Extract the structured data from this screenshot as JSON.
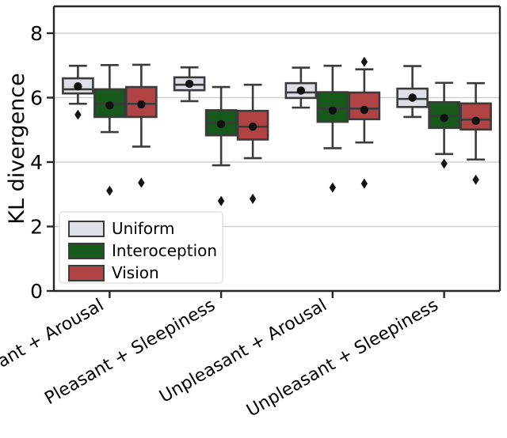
{
  "chart_data": {
    "type": "box",
    "title": "",
    "xlabel": "",
    "ylabel": "KL divergence",
    "ylim": [
      0,
      8.9
    ],
    "yticks": [
      0,
      2,
      4,
      6,
      8
    ],
    "ytick_labels": [
      "0",
      "2",
      "4",
      "6",
      "8"
    ],
    "grid": "horizontal",
    "categories": [
      "Pleasant + Arousal",
      "Pleasant + Sleepiness",
      "Unpleasant + Arousal",
      "Unpleasant + Sleepiness"
    ],
    "xtick_rotation": -30,
    "legend": {
      "position": "lower left",
      "entries": [
        {
          "name": "Uniform",
          "color": "#dee0e8"
        },
        {
          "name": "Interoception",
          "color": "#17591b"
        },
        {
          "name": "Vision",
          "color": "#b04343"
        }
      ]
    },
    "series": [
      {
        "name": "Uniform",
        "color": "#dee0e8",
        "boxes": [
          {
            "category": "Pleasant + Arousal",
            "whisker_low": 5.81,
            "q1": 6.13,
            "median": 6.26,
            "q3": 6.6,
            "whisker_high": 6.99,
            "mean": 6.35,
            "outliers": [
              5.47
            ]
          },
          {
            "category": "Pleasant + Sleepiness",
            "whisker_low": 5.89,
            "q1": 6.23,
            "median": 6.4,
            "q3": 6.63,
            "whisker_high": 6.94,
            "mean": 6.43,
            "outliers": []
          },
          {
            "category": "Unpleasant + Arousal",
            "whisker_low": 5.69,
            "q1": 5.99,
            "median": 6.16,
            "q3": 6.45,
            "whisker_high": 6.93,
            "mean": 6.22,
            "outliers": []
          },
          {
            "category": "Unpleasant + Sleepiness",
            "whisker_low": 5.4,
            "q1": 5.71,
            "median": 5.96,
            "q3": 6.28,
            "whisker_high": 6.98,
            "mean": 6.0,
            "outliers": []
          }
        ]
      },
      {
        "name": "Interoception",
        "color": "#17591b",
        "boxes": [
          {
            "category": "Pleasant + Arousal",
            "whisker_low": 4.93,
            "q1": 5.4,
            "median": 5.81,
            "q3": 6.26,
            "whisker_high": 7.01,
            "mean": 5.76,
            "outliers": [
              3.11
            ]
          },
          {
            "category": "Pleasant + Sleepiness",
            "whisker_low": 3.9,
            "q1": 4.83,
            "median": 5.23,
            "q3": 5.61,
            "whisker_high": 6.33,
            "mean": 5.18,
            "outliers": [
              2.79
            ]
          },
          {
            "category": "Unpleasant + Arousal",
            "whisker_low": 4.43,
            "q1": 5.25,
            "median": 5.66,
            "q3": 6.17,
            "whisker_high": 6.99,
            "mean": 5.6,
            "outliers": [
              3.21
            ]
          },
          {
            "category": "Unpleasant + Sleepiness",
            "whisker_low": 4.25,
            "q1": 5.06,
            "median": 5.44,
            "q3": 5.86,
            "whisker_high": 6.46,
            "mean": 5.37,
            "outliers": [
              3.95
            ]
          }
        ]
      },
      {
        "name": "Vision",
        "color": "#b04343",
        "boxes": [
          {
            "category": "Pleasant + Arousal",
            "whisker_low": 4.48,
            "q1": 5.4,
            "median": 5.81,
            "q3": 6.33,
            "whisker_high": 7.02,
            "mean": 5.79,
            "outliers": [
              3.36
            ]
          },
          {
            "category": "Pleasant + Sleepiness",
            "whisker_low": 4.12,
            "q1": 4.7,
            "median": 5.1,
            "q3": 5.59,
            "whisker_high": 6.4,
            "mean": 5.1,
            "outliers": [
              2.86
            ]
          },
          {
            "category": "Unpleasant + Arousal",
            "whisker_low": 4.61,
            "q1": 5.33,
            "median": 5.66,
            "q3": 6.16,
            "whisker_high": 6.88,
            "mean": 5.62,
            "outliers": [
              3.33,
              7.11
            ]
          },
          {
            "category": "Unpleasant + Sleepiness",
            "whisker_low": 4.08,
            "q1": 5.01,
            "median": 5.32,
            "q3": 5.82,
            "whisker_high": 6.45,
            "mean": 5.28,
            "outliers": [
              3.45
            ]
          }
        ]
      }
    ]
  }
}
